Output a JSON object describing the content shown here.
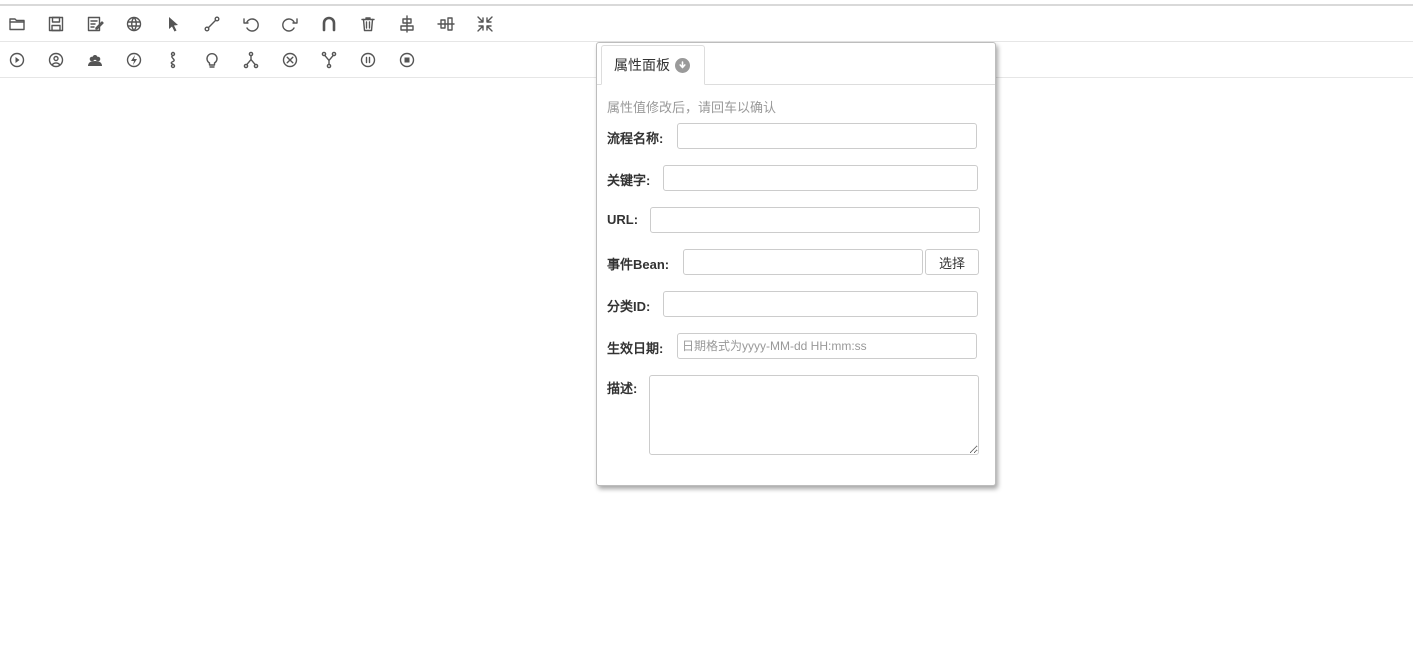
{
  "toolbar_top": {
    "tools": [
      {
        "icon": "folder-open-icon"
      },
      {
        "icon": "save-icon"
      },
      {
        "icon": "edit-document-icon"
      },
      {
        "icon": "globe-icon"
      },
      {
        "icon": "pointer-icon"
      },
      {
        "icon": "connection-line-icon"
      },
      {
        "icon": "undo-icon"
      },
      {
        "icon": "redo-icon"
      },
      {
        "icon": "magnet-icon"
      },
      {
        "icon": "trash-icon"
      },
      {
        "icon": "align-vertical-icon"
      },
      {
        "icon": "align-horizontal-icon"
      },
      {
        "icon": "collapse-icon"
      }
    ]
  },
  "toolbar_nodes": {
    "tools": [
      {
        "icon": "start-node-icon"
      },
      {
        "icon": "user-task-icon"
      },
      {
        "icon": "group-task-icon"
      },
      {
        "icon": "event-node-icon"
      },
      {
        "icon": "sub-process-icon"
      },
      {
        "icon": "rule-node-icon"
      },
      {
        "icon": "fork-icon"
      },
      {
        "icon": "terminate-icon"
      },
      {
        "icon": "join-icon"
      },
      {
        "icon": "pause-node-icon"
      },
      {
        "icon": "end-node-icon"
      }
    ]
  },
  "panel": {
    "tab_label": "属性面板",
    "hint": "属性值修改后，请回车以确认",
    "fields": {
      "process_name": {
        "label": "流程名称:",
        "value": ""
      },
      "keyword": {
        "label": "关键字:",
        "value": ""
      },
      "url": {
        "label": "URL:",
        "value": ""
      },
      "event_bean": {
        "label": "事件Bean:",
        "value": "",
        "button": "选择"
      },
      "category_id": {
        "label": "分类ID:",
        "value": ""
      },
      "effective_date": {
        "label": "生效日期:",
        "value": "",
        "placeholder": "日期格式为yyyy-MM-dd HH:mm:ss"
      },
      "description": {
        "label": "描述:",
        "value": ""
      }
    }
  }
}
